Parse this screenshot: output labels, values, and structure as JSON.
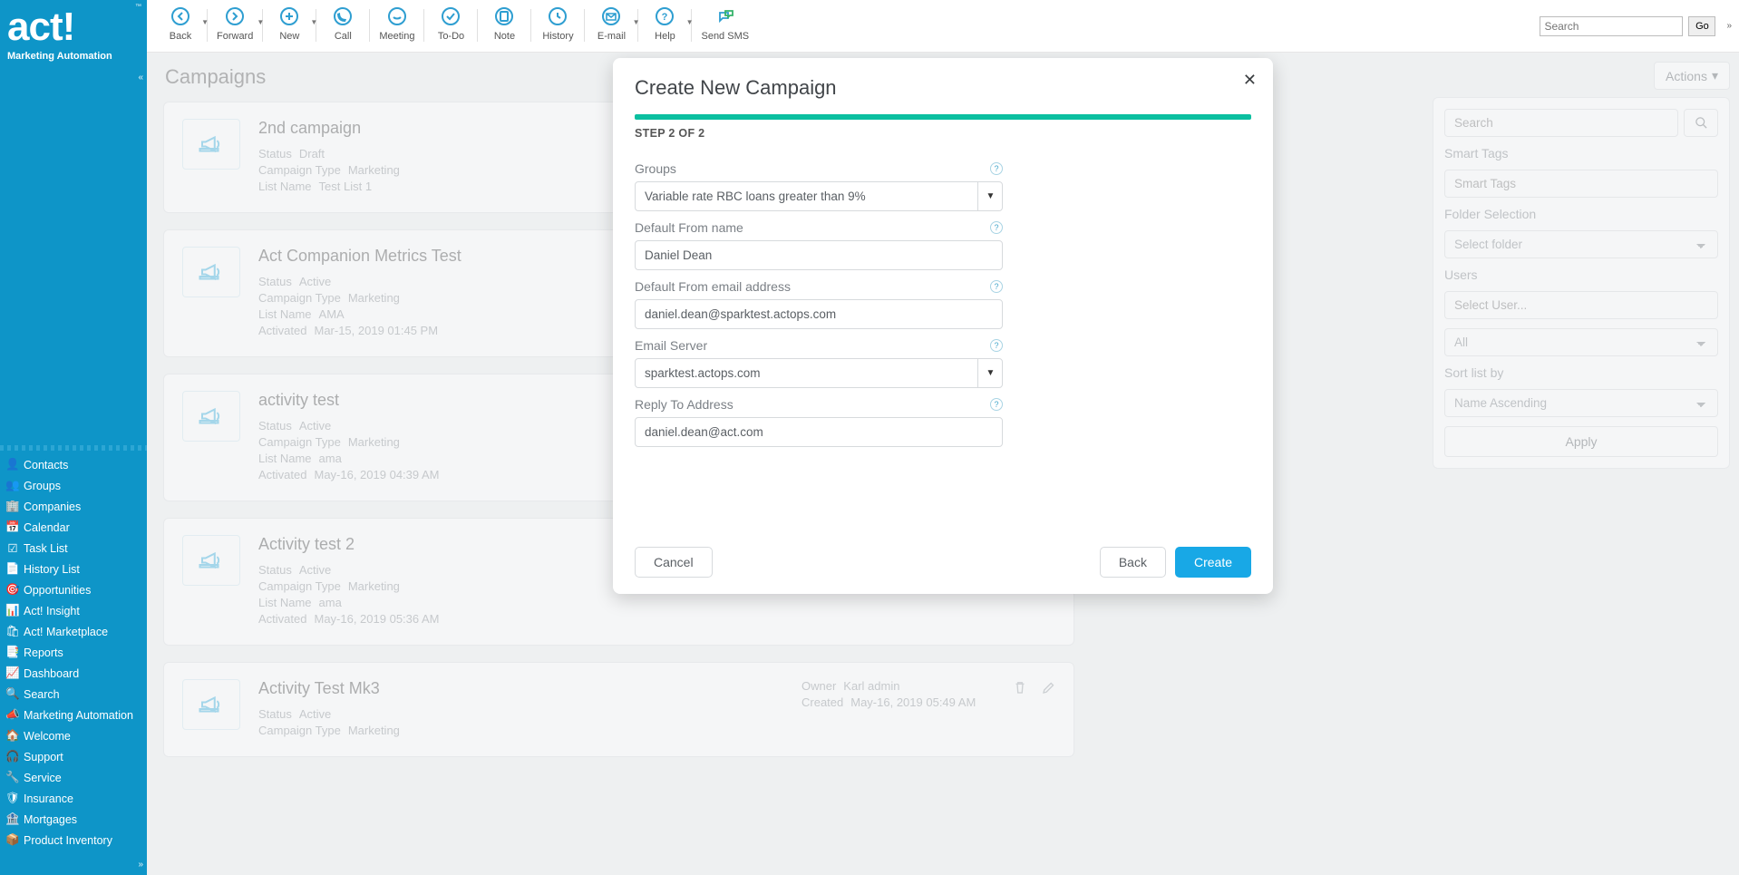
{
  "app": {
    "name": "act!",
    "subtitle": "Marketing Automation"
  },
  "nav": [
    {
      "label": "Contacts",
      "icon": "person-icon"
    },
    {
      "label": "Groups",
      "icon": "people-icon"
    },
    {
      "label": "Companies",
      "icon": "building-icon"
    },
    {
      "label": "Calendar",
      "icon": "calendar-icon"
    },
    {
      "label": "Task List",
      "icon": "check-icon"
    },
    {
      "label": "History List",
      "icon": "note-icon"
    },
    {
      "label": "Opportunities",
      "icon": "target-icon"
    },
    {
      "label": "Act! Insight",
      "icon": "chart-icon"
    },
    {
      "label": "Act! Marketplace",
      "icon": "cart-icon"
    },
    {
      "label": "Reports",
      "icon": "report-icon"
    },
    {
      "label": "Dashboard",
      "icon": "gauge-icon"
    },
    {
      "label": "Search",
      "icon": "search-icon"
    },
    {
      "label": "Marketing Automation",
      "icon": "megaphone-icon"
    },
    {
      "label": "Welcome",
      "icon": "home-icon"
    },
    {
      "label": "Support",
      "icon": "headset-icon"
    },
    {
      "label": "Service",
      "icon": "wrench-icon"
    },
    {
      "label": "Insurance",
      "icon": "shield-icon"
    },
    {
      "label": "Mortgages",
      "icon": "bank-icon"
    },
    {
      "label": "Product Inventory",
      "icon": "box-icon"
    }
  ],
  "toolbar": {
    "search_placeholder": "Search",
    "go": "Go",
    "items": [
      {
        "label": "Back",
        "caret": true
      },
      {
        "label": "Forward",
        "caret": true
      },
      {
        "label": "New",
        "caret": true
      },
      {
        "label": "Call",
        "caret": false
      },
      {
        "label": "Meeting",
        "caret": false
      },
      {
        "label": "To-Do",
        "caret": false
      },
      {
        "label": "Note",
        "caret": false
      },
      {
        "label": "History",
        "caret": false
      },
      {
        "label": "E-mail",
        "caret": true
      },
      {
        "label": "Help",
        "caret": true
      },
      {
        "label": "Send SMS",
        "caret": false
      }
    ]
  },
  "page": {
    "title": "Campaigns",
    "actions_label": "Actions"
  },
  "filters": {
    "search_placeholder": "Search",
    "smart_tags_label": "Smart Tags",
    "smart_tags_placeholder": "Smart Tags",
    "folder_label": "Folder Selection",
    "folder_placeholder": "Select folder",
    "users_label": "Users",
    "users_placeholder": "Select User...",
    "all_option": "All",
    "sort_label": "Sort list by",
    "sort_value": "Name Ascending",
    "apply": "Apply"
  },
  "campaigns": [
    {
      "title": "2nd campaign",
      "lines": [
        [
          "Status",
          "Draft"
        ],
        [
          "Campaign Type",
          "Marketing"
        ],
        [
          "List Name",
          "Test List 1"
        ]
      ]
    },
    {
      "title": "Act Companion Metrics Test",
      "lines": [
        [
          "Status",
          "Active"
        ],
        [
          "Campaign Type",
          "Marketing"
        ],
        [
          "List Name",
          "AMA"
        ],
        [
          "Activated",
          "Mar-15, 2019 01:45 PM"
        ]
      ]
    },
    {
      "title": "activity test",
      "lines": [
        [
          "Status",
          "Active"
        ],
        [
          "Campaign Type",
          "Marketing"
        ],
        [
          "List Name",
          "ama"
        ],
        [
          "Activated",
          "May-16, 2019 04:39 AM"
        ]
      ]
    },
    {
      "title": "Activity test 2",
      "lines": [
        [
          "Status",
          "Active"
        ],
        [
          "Campaign Type",
          "Marketing"
        ],
        [
          "List Name",
          "ama"
        ],
        [
          "Activated",
          "May-16, 2019 05:36 AM"
        ]
      ]
    },
    {
      "title": "Activity Test Mk3",
      "lines": [
        [
          "Status",
          "Active"
        ],
        [
          "Campaign Type",
          "Marketing"
        ]
      ],
      "owner": [
        [
          "Owner",
          "Karl admin"
        ],
        [
          "Created",
          "May-16, 2019 05:49 AM"
        ]
      ],
      "show_icons": true
    }
  ],
  "modal": {
    "title": "Create New Campaign",
    "step": "STEP 2 OF 2",
    "groups_label": "Groups",
    "groups_value": "Variable rate RBC loans greater than 9%",
    "from_name_label": "Default From name",
    "from_name_value": "Daniel Dean",
    "from_email_label": "Default From email address",
    "from_email_value": "daniel.dean@sparktest.actops.com",
    "server_label": "Email Server",
    "server_value": "sparktest.actops.com",
    "reply_label": "Reply To Address",
    "reply_value": "daniel.dean@act.com",
    "cancel": "Cancel",
    "back": "Back",
    "create": "Create"
  }
}
